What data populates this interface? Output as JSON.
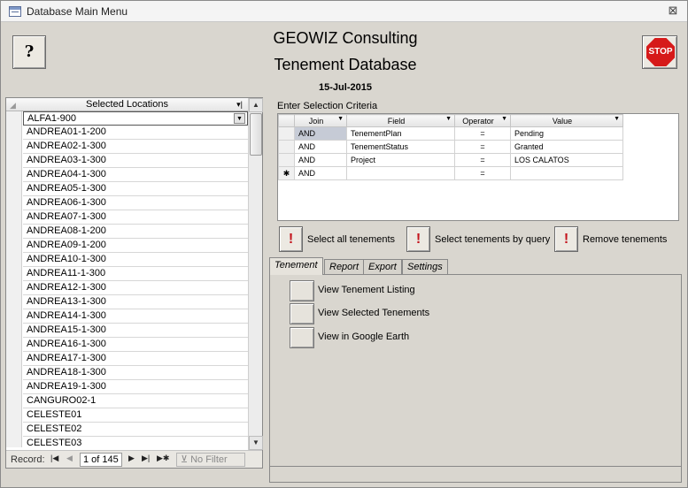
{
  "window": {
    "title": "Database Main Menu",
    "close_glyph": "⊠"
  },
  "header": {
    "company": "GEOWIZ Consulting",
    "database": "Tenement Database",
    "date": "15-Jul-2015",
    "help_glyph": "?",
    "stop_label": "STOP"
  },
  "locations": {
    "header": "Selected Locations",
    "current": "ALFA1-900",
    "items": [
      "ANDREA01-1-200",
      "ANDREA02-1-300",
      "ANDREA03-1-300",
      "ANDREA04-1-300",
      "ANDREA05-1-300",
      "ANDREA06-1-300",
      "ANDREA07-1-300",
      "ANDREA08-1-200",
      "ANDREA09-1-200",
      "ANDREA10-1-300",
      "ANDREA11-1-300",
      "ANDREA12-1-300",
      "ANDREA13-1-300",
      "ANDREA14-1-300",
      "ANDREA15-1-300",
      "ANDREA16-1-300",
      "ANDREA17-1-300",
      "ANDREA18-1-300",
      "ANDREA19-1-300",
      "CANGURO02-1",
      "CELESTE01",
      "CELESTE02",
      "CELESTE03"
    ]
  },
  "record_nav": {
    "label": "Record:",
    "position": "1 of 145",
    "filter": "No Filter"
  },
  "criteria": {
    "label": "Enter Selection Criteria",
    "columns": [
      "Join",
      "Field",
      "Operator",
      "Value"
    ],
    "rows": [
      {
        "join": "AND",
        "field": "TenementPlan",
        "op": "=",
        "value": "Pending"
      },
      {
        "join": "AND",
        "field": "TenementStatus",
        "op": "=",
        "value": "Granted"
      },
      {
        "join": "AND",
        "field": "Project",
        "op": "=",
        "value": "LOS CALATOS"
      }
    ],
    "new_row": {
      "join": "AND",
      "op": "=",
      "marker": "✱"
    }
  },
  "actions": {
    "select_all": "Select all tenements",
    "select_query": "Select tenements by query",
    "remove": "Remove tenements"
  },
  "tabs": [
    "Tenement",
    "Report",
    "Export",
    "Settings"
  ],
  "tenement_tab": {
    "view_listing": "View Tenement Listing",
    "view_selected": "View Selected Tenements",
    "view_google": "View in Google Earth"
  }
}
